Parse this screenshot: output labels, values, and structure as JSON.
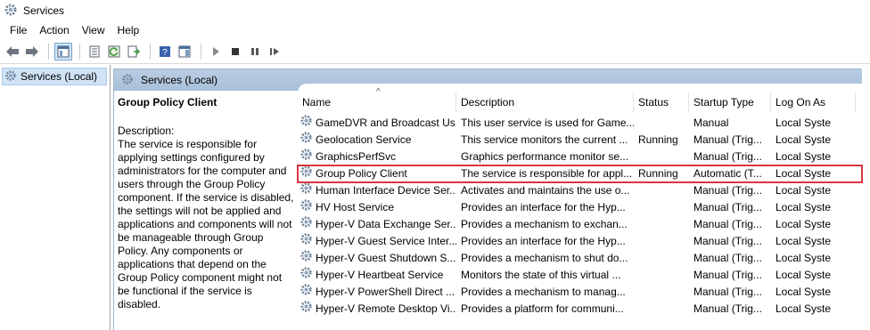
{
  "window": {
    "title": "Services"
  },
  "menu": [
    "File",
    "Action",
    "View",
    "Help"
  ],
  "tree": {
    "root_label": "Services (Local)"
  },
  "main": {
    "header_label": "Services (Local)"
  },
  "description": {
    "service_title": "Group Policy Client",
    "label": "Description:",
    "text": "The service is responsible for applying settings configured by administrators for the computer and users through the Group Policy component. If the service is disabled, the settings will not be applied and applications and components will not be manageable through Group Policy. Any components or applications that depend on the Group Policy component might not be functional if the service is disabled."
  },
  "table": {
    "columns": [
      "Name",
      "Description",
      "Status",
      "Startup Type",
      "Log On As"
    ],
    "rows": [
      {
        "name": "GameDVR and Broadcast Us...",
        "description": "This user service is used for Game...",
        "status": "",
        "startup": "Manual",
        "logon": "Local Syste"
      },
      {
        "name": "Geolocation Service",
        "description": "This service monitors the current ...",
        "status": "Running",
        "startup": "Manual (Trig...",
        "logon": "Local Syste"
      },
      {
        "name": "GraphicsPerfSvc",
        "description": "Graphics performance monitor se...",
        "status": "",
        "startup": "Manual (Trig...",
        "logon": "Local Syste"
      },
      {
        "name": "Group Policy Client",
        "description": "The service is responsible for appl...",
        "status": "Running",
        "startup": "Automatic (T...",
        "logon": "Local Syste"
      },
      {
        "name": "Human Interface Device Ser...",
        "description": "Activates and maintains the use o...",
        "status": "",
        "startup": "Manual (Trig...",
        "logon": "Local Syste"
      },
      {
        "name": "HV Host Service",
        "description": "Provides an interface for the Hyp...",
        "status": "",
        "startup": "Manual (Trig...",
        "logon": "Local Syste"
      },
      {
        "name": "Hyper-V Data Exchange Ser...",
        "description": "Provides a mechanism to exchan...",
        "status": "",
        "startup": "Manual (Trig...",
        "logon": "Local Syste"
      },
      {
        "name": "Hyper-V Guest Service Inter...",
        "description": "Provides an interface for the Hyp...",
        "status": "",
        "startup": "Manual (Trig...",
        "logon": "Local Syste"
      },
      {
        "name": "Hyper-V Guest Shutdown S...",
        "description": "Provides a mechanism to shut do...",
        "status": "",
        "startup": "Manual (Trig...",
        "logon": "Local Syste"
      },
      {
        "name": "Hyper-V Heartbeat Service",
        "description": "Monitors the state of this virtual ...",
        "status": "",
        "startup": "Manual (Trig...",
        "logon": "Local Syste"
      },
      {
        "name": "Hyper-V PowerShell Direct ...",
        "description": "Provides a mechanism to manag...",
        "status": "",
        "startup": "Manual (Trig...",
        "logon": "Local Syste"
      },
      {
        "name": "Hyper-V Remote Desktop Vi...",
        "description": "Provides a platform for communi...",
        "status": "",
        "startup": "Manual (Trig...",
        "logon": "Local Syste"
      }
    ]
  },
  "colors": {
    "selection_outline": "#d9363e",
    "header_gradient": "#b9cde3"
  },
  "icons": {
    "app": "gear-icon",
    "service": "service-gear-icon"
  }
}
